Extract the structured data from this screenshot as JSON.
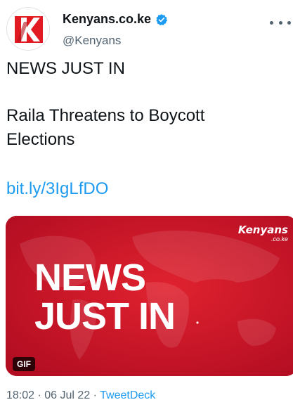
{
  "account": {
    "display_name": "Kenyans.co.ke",
    "handle": "@Kenyans",
    "avatar_letter": "K",
    "verified": true
  },
  "tweet": {
    "line1": "NEWS JUST IN",
    "line2": "Raila Threatens to Boycott",
    "line3": "Elections",
    "link": "bit.ly/3IgLfDO"
  },
  "media": {
    "headline_line1": "NEWS",
    "headline_line2": "JUST IN",
    "brand_name": "Kenyans",
    "brand_sub": ".co.ke",
    "badge": "GIF"
  },
  "meta": {
    "time": "18:02",
    "separator": "·",
    "date": "06 Jul 22",
    "client": "TweetDeck"
  },
  "colors": {
    "accent": "#1d9bf0",
    "media_red": "#c8102e",
    "secondary_text": "#536471"
  },
  "icons": {
    "verified": "verified-badge-icon",
    "more": "more-options-icon"
  }
}
